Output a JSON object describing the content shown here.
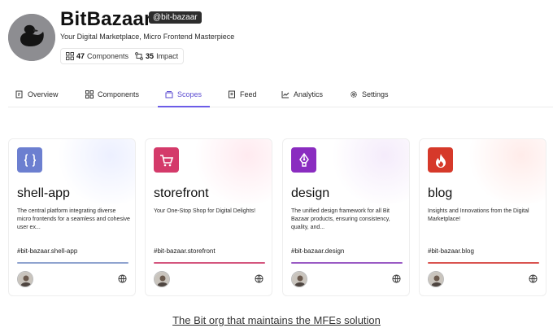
{
  "org": {
    "name": "BitBazaar",
    "handle": "@bit-bazaar",
    "tagline": "Your Digital Marketplace, Micro Frontend Masterpiece",
    "stats": {
      "components_count": "47",
      "components_label": "Components",
      "impact_count": "35",
      "impact_label": "Impact"
    }
  },
  "tabs": [
    {
      "label": "Overview",
      "icon": "overview-icon"
    },
    {
      "label": "Components",
      "icon": "grid-icon"
    },
    {
      "label": "Scopes",
      "icon": "scopes-icon",
      "active": true
    },
    {
      "label": "Feed",
      "icon": "feed-icon"
    },
    {
      "label": "Analytics",
      "icon": "analytics-icon"
    },
    {
      "label": "Settings",
      "icon": "gear-icon"
    }
  ],
  "scopes": [
    {
      "name": "shell-app",
      "description": "The central platform integrating diverse micro frontends for a seamless and cohesive user ex...",
      "id": "#bit-bazaar.shell-app",
      "icon": "braces-icon",
      "color": "#6c7fd0",
      "bar_color": "#8fa3cf",
      "glow": "#dde3ff"
    },
    {
      "name": "storefront",
      "description": "Your One-Stop Shop for Digital Delights!",
      "id": "#bit-bazaar.storefront",
      "icon": "cart-icon",
      "color": "#d43a6a",
      "bar_color": "#d4557e",
      "glow": "#ffd9e3"
    },
    {
      "name": "design",
      "description": "The unified design framework for all Bit Bazaar products, ensuring consistency, quality, and...",
      "id": "#bit-bazaar.design",
      "icon": "pen-tool-icon",
      "color": "#8a2cc0",
      "bar_color": "#9a5ac4",
      "glow": "#ecdcf7"
    },
    {
      "name": "blog",
      "description": "Insights and Innovations from the Digital Marketplace!",
      "id": "#bit-bazaar.blog",
      "icon": "flame-icon",
      "color": "#d6392a",
      "bar_color": "#d9534f",
      "glow": "#ffdcd8"
    }
  ],
  "footer": {
    "link_text": "The Bit org that maintains the MFEs solution"
  }
}
